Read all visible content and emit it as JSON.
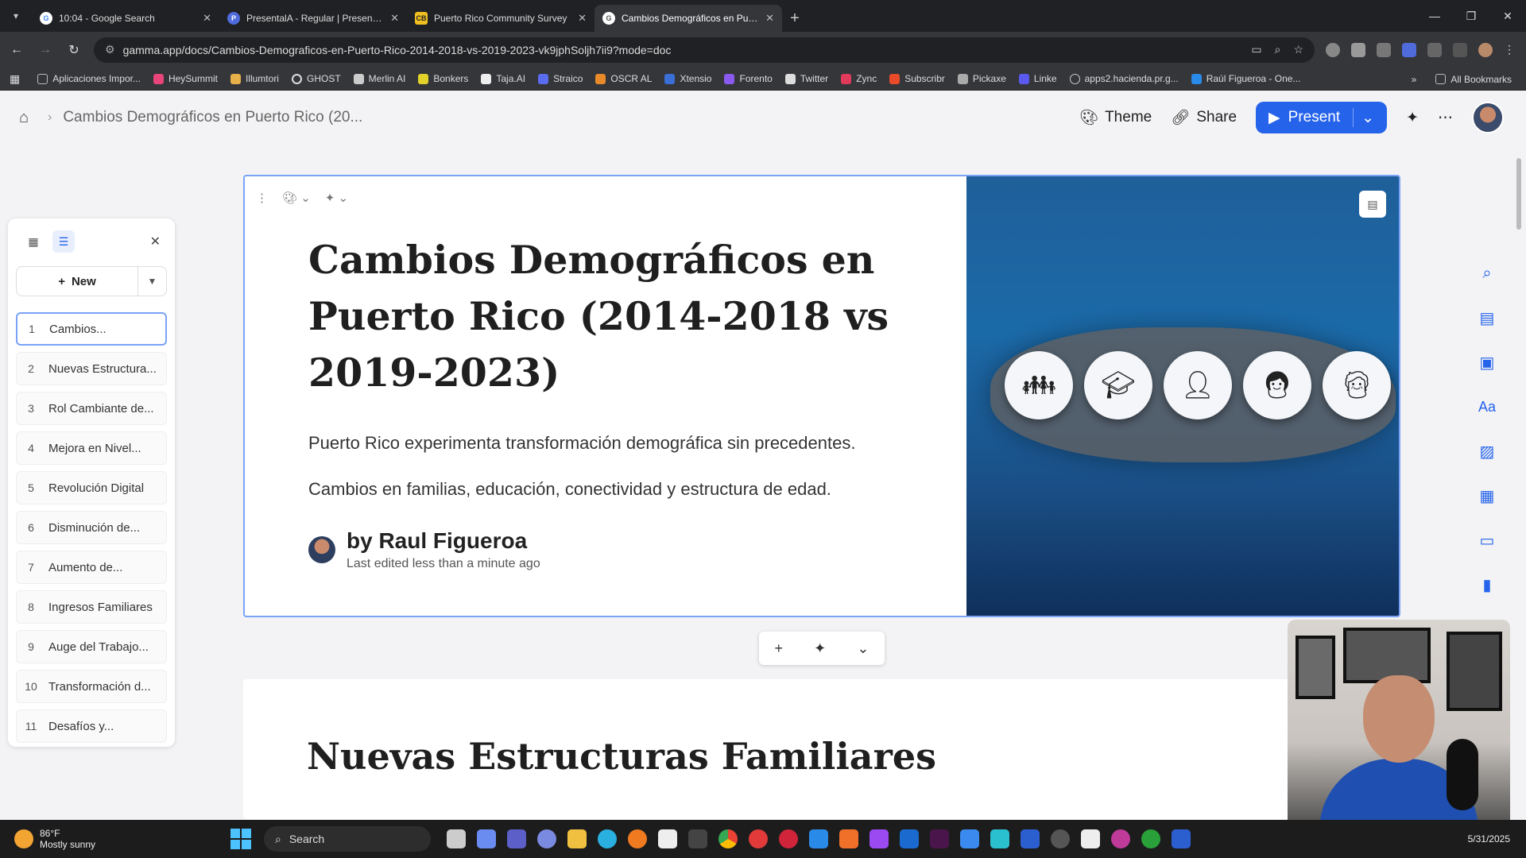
{
  "browser": {
    "tabs": [
      {
        "title": "10:04 - Google Search",
        "fav": "G",
        "color": "#4285f4"
      },
      {
        "title": "PresentalA - Regular | Presenta...",
        "fav": "P",
        "color": "#4f6bdc"
      },
      {
        "title": "Puerto Rico Community Survey",
        "fav": "CB",
        "color": "#f0c020"
      },
      {
        "title": "Cambios Demográficos en Pue...",
        "fav": "G",
        "color": "#9aa0a6"
      }
    ],
    "url": "gamma.app/docs/Cambios-Demograficos-en-Puerto-Rico-2014-2018-vs-2019-2023-vk9jphSoljh7ii9?mode=doc",
    "bookmarks": [
      "Aplicaciones Impor...",
      "HeySummit",
      "Illumtori",
      "GHOST",
      "Merlin AI",
      "Bonkers",
      "Taja.AI",
      "Straico",
      "OSCR AL",
      "Xtensio",
      "Forento",
      "Twitter",
      "Zync",
      "Subscribr",
      "Pickaxe",
      "Linke",
      "apps2.hacienda.pr.g...",
      "Raúl Figueroa - One..."
    ],
    "all_bookmarks": "All Bookmarks"
  },
  "header": {
    "breadcrumb": "Cambios Demográficos en Puerto Rico (20...",
    "theme": "Theme",
    "share": "Share",
    "present": "Present"
  },
  "sidebar": {
    "new_label": "New",
    "slides": [
      {
        "num": "1",
        "label": "Cambios..."
      },
      {
        "num": "2",
        "label": "Nuevas Estructura..."
      },
      {
        "num": "3",
        "label": "Rol Cambiante de..."
      },
      {
        "num": "4",
        "label": "Mejora en Nivel..."
      },
      {
        "num": "5",
        "label": "Revolución Digital"
      },
      {
        "num": "6",
        "label": "Disminución de..."
      },
      {
        "num": "7",
        "label": "Aumento de..."
      },
      {
        "num": "8",
        "label": "Ingresos Familiares"
      },
      {
        "num": "9",
        "label": "Auge del Trabajo..."
      },
      {
        "num": "10",
        "label": "Transformación d..."
      },
      {
        "num": "11",
        "label": "Desafíos y..."
      }
    ]
  },
  "card": {
    "title": "Cambios Demográficos en Puerto Rico (2014-2018 vs 2019-2023)",
    "subtitle1": "Puerto Rico experimenta transformación demográfica sin precedentes.",
    "subtitle2": "Cambios en familias, educación, conectividad y estructura de edad.",
    "author": "by Raul Figueroa",
    "edited": "Last edited less than a minute ago"
  },
  "card2": {
    "title": "Nuevas Estructuras Familiares"
  },
  "taskbar": {
    "temp": "86°F",
    "weather": "Mostly sunny",
    "search": "Search",
    "date": "5/31/2025"
  }
}
